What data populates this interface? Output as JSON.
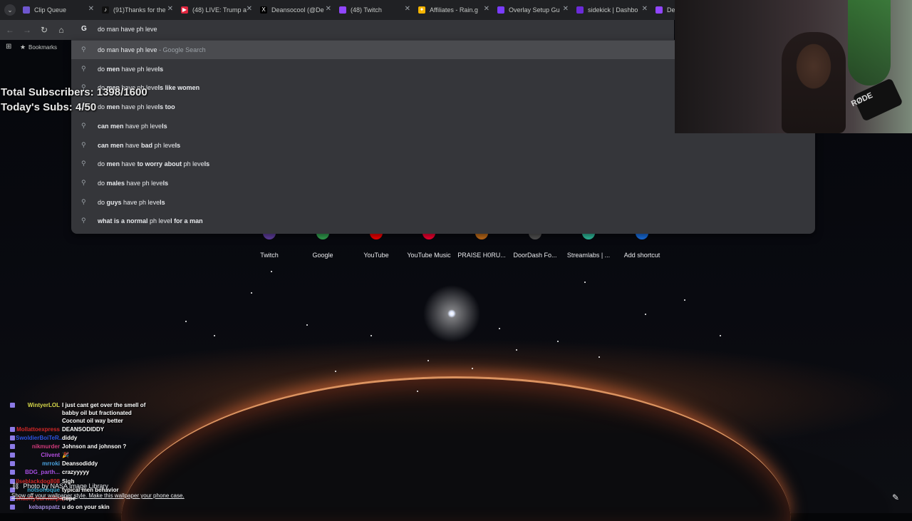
{
  "tabs": [
    {
      "title": "Clip Queue",
      "fav_color": "#6e56cf",
      "fav_glyph": ""
    },
    {
      "title": "(91)Thanks for the",
      "fav_color": "#111111",
      "fav_glyph": "♪"
    },
    {
      "title": "(48) LIVE: Trump a",
      "fav_color": "#e0263f",
      "fav_glyph": "▶"
    },
    {
      "title": "Deansocool (@De",
      "fav_color": "#000000",
      "fav_glyph": "X"
    },
    {
      "title": "(48) Twitch",
      "fav_color": "#9146ff",
      "fav_glyph": ""
    },
    {
      "title": "Affiliates - Rain.g",
      "fav_color": "#f5b400",
      "fav_glyph": "✦"
    },
    {
      "title": "Overlay Setup Gu",
      "fav_color": "#7a3cff",
      "fav_glyph": ""
    },
    {
      "title": "sidekick | Dashbo",
      "fav_color": "#6b2bd9",
      "fav_glyph": ""
    },
    {
      "title": "Dea",
      "fav_color": "#9146ff",
      "fav_glyph": ""
    }
  ],
  "omnibox": {
    "google_glyph": "G",
    "query": "do man have ph leve"
  },
  "bookmarks": {
    "label": "Bookmarks"
  },
  "suggestions": [
    {
      "parts": [
        {
          "t": "do man have ph leve",
          "b": false
        }
      ],
      "suffix": " - Google Search"
    },
    {
      "parts": [
        {
          "t": "do ",
          "b": false
        },
        {
          "t": "men",
          "b": true
        },
        {
          "t": " have ph leve",
          "b": false
        },
        {
          "t": "ls",
          "b": true
        }
      ],
      "suffix": ""
    },
    {
      "parts": [
        {
          "t": "do ",
          "b": false
        },
        {
          "t": "men",
          "b": true
        },
        {
          "t": " have ph leve",
          "b": false
        },
        {
          "t": "ls like women",
          "b": true
        }
      ],
      "suffix": ""
    },
    {
      "parts": [
        {
          "t": "do ",
          "b": false
        },
        {
          "t": "men",
          "b": true
        },
        {
          "t": " have ph leve",
          "b": false
        },
        {
          "t": "ls too",
          "b": true
        }
      ],
      "suffix": ""
    },
    {
      "parts": [
        {
          "t": "can men",
          "b": true
        },
        {
          "t": " have ph leve",
          "b": false
        },
        {
          "t": "ls",
          "b": true
        }
      ],
      "suffix": ""
    },
    {
      "parts": [
        {
          "t": "can men",
          "b": true
        },
        {
          "t": " have ",
          "b": false
        },
        {
          "t": "bad",
          "b": true
        },
        {
          "t": " ph leve",
          "b": false
        },
        {
          "t": "ls",
          "b": true
        }
      ],
      "suffix": ""
    },
    {
      "parts": [
        {
          "t": "do ",
          "b": false
        },
        {
          "t": "men",
          "b": true
        },
        {
          "t": " have ",
          "b": false
        },
        {
          "t": "to worry about",
          "b": true
        },
        {
          "t": " ph leve",
          "b": false
        },
        {
          "t": "ls",
          "b": true
        }
      ],
      "suffix": ""
    },
    {
      "parts": [
        {
          "t": "do ",
          "b": false
        },
        {
          "t": "males",
          "b": true
        },
        {
          "t": " have ph leve",
          "b": false
        },
        {
          "t": "ls",
          "b": true
        }
      ],
      "suffix": ""
    },
    {
      "parts": [
        {
          "t": "do ",
          "b": false
        },
        {
          "t": "guys",
          "b": true
        },
        {
          "t": " have ph leve",
          "b": false
        },
        {
          "t": "ls",
          "b": true
        }
      ],
      "suffix": ""
    },
    {
      "parts": [
        {
          "t": "what is a normal",
          "b": true
        },
        {
          "t": " ph leve",
          "b": false
        },
        {
          "t": "l for a man",
          "b": true
        }
      ],
      "suffix": ""
    }
  ],
  "overlay": {
    "total_subs": "Total Subscribers: 1398/1600",
    "today_subs": "Today's Subs: 4/50"
  },
  "webcam": {
    "mic_brand": "RØDE"
  },
  "shortcuts": [
    {
      "label": "Twitch",
      "color": "#6441a5"
    },
    {
      "label": "Google",
      "color": "#34a853"
    },
    {
      "label": "YouTube",
      "color": "#ff0000"
    },
    {
      "label": "YouTube Music",
      "color": "#ff0033"
    },
    {
      "label": "PRAISE H0RU...",
      "color": "#c8701a"
    },
    {
      "label": "DoorDash Fo...",
      "color": "#555555"
    },
    {
      "label": "Streamlabs | ...",
      "color": "#31c3a2"
    },
    {
      "label": "Add shortcut",
      "color": "#1a73e8"
    }
  ],
  "chat": [
    {
      "user": "WintyerLOL",
      "color": "#d6d84a",
      "msg": "I just cant get over the smell of"
    },
    {
      "user": "",
      "color": "#ffffff",
      "msg": "babby oil but fractionated"
    },
    {
      "user": "",
      "color": "#ffffff",
      "msg": "Coconut oil way better"
    },
    {
      "user": "Mollattoexpress",
      "color": "#d02727",
      "msg": "DEANSODIDDY"
    },
    {
      "user": "SwoldierBoiTeR...",
      "color": "#2d52e0",
      "msg": "diddy"
    },
    {
      "user": "nikmurder",
      "color": "#d13a7a",
      "msg": "Johnson and johnson ?"
    },
    {
      "user": "Clivent",
      "color": "#b54ee0",
      "msg": "🎉"
    },
    {
      "user": "mrroki",
      "color": "#4aa3e0",
      "msg": "Deansodiddy"
    },
    {
      "user": "BDG_parth...",
      "color": "#a64ee0",
      "msg": "crazyyyyy"
    },
    {
      "user": "ilseblackdog808",
      "color": "#d02727",
      "msg": "Sigh"
    },
    {
      "user": "notsohoque",
      "color": "#3aa9d0",
      "msg": "typical men behavior"
    },
    {
      "user": "shaoffyourwallpaper",
      "color": "#d02727",
      "msg": "nope"
    },
    {
      "user": "kebapspatz",
      "color": "#a58ee0",
      "msg": "u do on your skin"
    }
  ],
  "credit": {
    "title": "Photo by NASA Image Library",
    "subtitle": "Show off your wallpaper style. Make this wallpaper your phone case."
  }
}
